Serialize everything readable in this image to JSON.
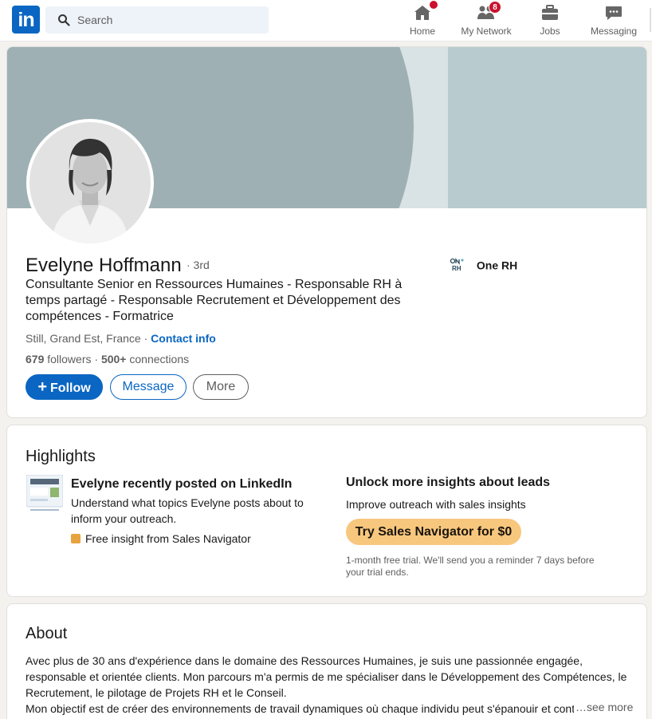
{
  "nav": {
    "logo_text": "in",
    "search_placeholder": "Search",
    "items": [
      {
        "label": "Home",
        "icon": "home-icon",
        "badge": ""
      },
      {
        "label": "My Network",
        "icon": "network-icon",
        "badge": "8"
      },
      {
        "label": "Jobs",
        "icon": "briefcase-icon",
        "badge": ""
      },
      {
        "label": "Messaging",
        "icon": "chat-icon",
        "badge": ""
      }
    ]
  },
  "profile": {
    "name": "Evelyne Hoffmann",
    "degree": "· 3rd",
    "headline": "Consultante Senior en Ressources Humaines - Responsable RH à temps partagé - Responsable Recrutement et Développement des compétences - Formatrice",
    "location": "Still, Grand Est, France",
    "location_sep": " · ",
    "contact_label": "Contact info",
    "followers_count": "679",
    "followers_label": " followers",
    "connections_sep": " · ",
    "connections_count": "500+",
    "connections_label": " connections",
    "company": "One RH",
    "buttons": {
      "follow": "Follow",
      "follow_plus": "+",
      "message": "Message",
      "more": "More"
    }
  },
  "highlights": {
    "title": "Highlights",
    "left_title": "Evelyne recently posted on LinkedIn",
    "left_desc": "Understand what topics Evelyne posts about to inform your outreach.",
    "free_insight": "Free insight from Sales Navigator",
    "right_title": "Unlock more insights about leads",
    "right_desc": "Improve outreach with sales insights",
    "cta": "Try Sales Navigator for $0",
    "note": "1-month free trial. We'll send you a reminder 7 days before your trial ends."
  },
  "about": {
    "title": "About",
    "para1": "Avec plus de 30 ans d'expérience dans le domaine des Ressources Humaines, je suis une passionnée engagée, responsable et orientée clients. Mon parcours m'a permis de me spécialiser dans le Développement des Compétences, le Recrutement, le pilotage de Projets RH et le Conseil.",
    "para2": "Mon objectif est de créer des environnements de travail dynamiques où chaque individu peut s'épanouir et contribuer",
    "see_more": "…see more"
  },
  "colors": {
    "accent": "#0a66c2",
    "badge": "#cb112d",
    "sales_navigator": "#f8c77e"
  }
}
